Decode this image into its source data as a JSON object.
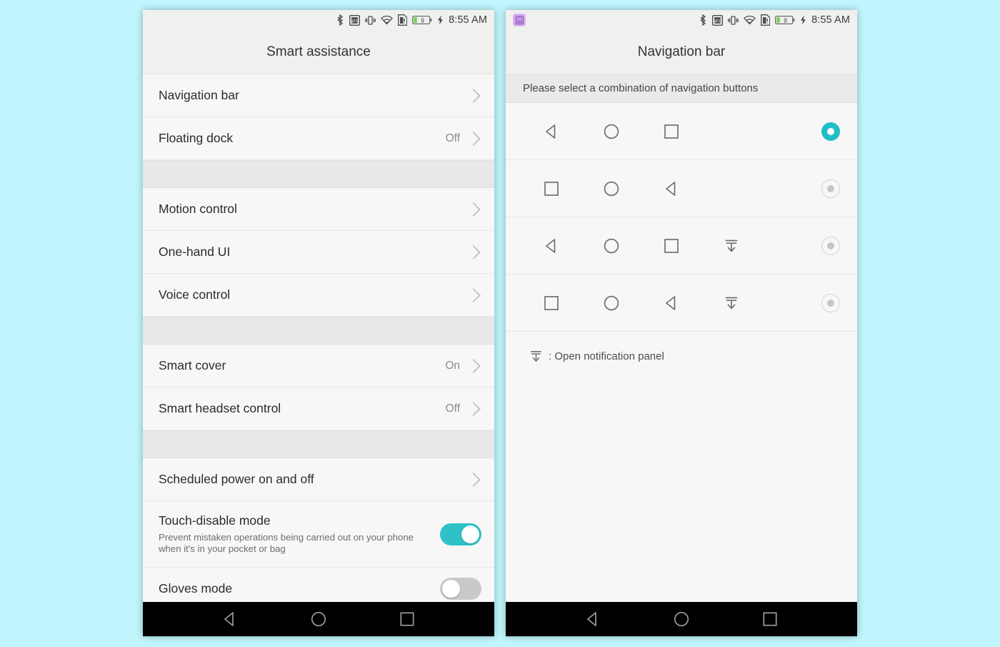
{
  "background_color": "#c2f6fe",
  "accent_color": "#2ec2c6",
  "statusbar": {
    "time": "8:55 AM",
    "battery_level": "9",
    "icons": [
      "bluetooth-icon",
      "nfc-icon",
      "vibrate-icon",
      "wifi-icon",
      "sim-card-icon",
      "battery-icon",
      "charging-bolt-icon"
    ],
    "notification_icon": "screenshot-notification-icon"
  },
  "left_phone": {
    "title": "Smart assistance",
    "groups": [
      {
        "rows": [
          {
            "label": "Navigation bar",
            "value": "",
            "type": "chevron"
          },
          {
            "label": "Floating dock",
            "value": "Off",
            "type": "chevron"
          }
        ]
      },
      {
        "rows": [
          {
            "label": "Motion control",
            "value": "",
            "type": "chevron"
          },
          {
            "label": "One-hand UI",
            "value": "",
            "type": "chevron"
          },
          {
            "label": "Voice control",
            "value": "",
            "type": "chevron"
          }
        ]
      },
      {
        "rows": [
          {
            "label": "Smart cover",
            "value": "On",
            "type": "chevron"
          },
          {
            "label": "Smart headset control",
            "value": "Off",
            "type": "chevron"
          }
        ]
      },
      {
        "rows": [
          {
            "label": "Scheduled power on and off",
            "value": "",
            "type": "chevron"
          },
          {
            "label": "Touch-disable mode",
            "sub": "Prevent mistaken operations being carried out on your phone when it's in your pocket or bag",
            "type": "toggle",
            "toggle_state": "on"
          },
          {
            "label": "Gloves mode",
            "value": "",
            "type": "toggle",
            "toggle_state": "off"
          }
        ]
      }
    ]
  },
  "right_phone": {
    "title": "Navigation bar",
    "hint": "Please select a combination of navigation buttons",
    "options": [
      {
        "buttons": [
          "back-icon",
          "home-icon",
          "recents-icon"
        ],
        "selected": true
      },
      {
        "buttons": [
          "recents-icon",
          "home-icon",
          "back-icon"
        ],
        "selected": false
      },
      {
        "buttons": [
          "back-icon",
          "home-icon",
          "recents-icon",
          "notification-panel-icon"
        ],
        "selected": false
      },
      {
        "buttons": [
          "recents-icon",
          "home-icon",
          "back-icon",
          "notification-panel-icon"
        ],
        "selected": false
      }
    ],
    "legend": {
      "icon": "notification-panel-icon",
      "text": ": Open notification panel"
    }
  },
  "android_nav": {
    "buttons": [
      "back-icon",
      "home-icon",
      "recents-icon"
    ]
  }
}
